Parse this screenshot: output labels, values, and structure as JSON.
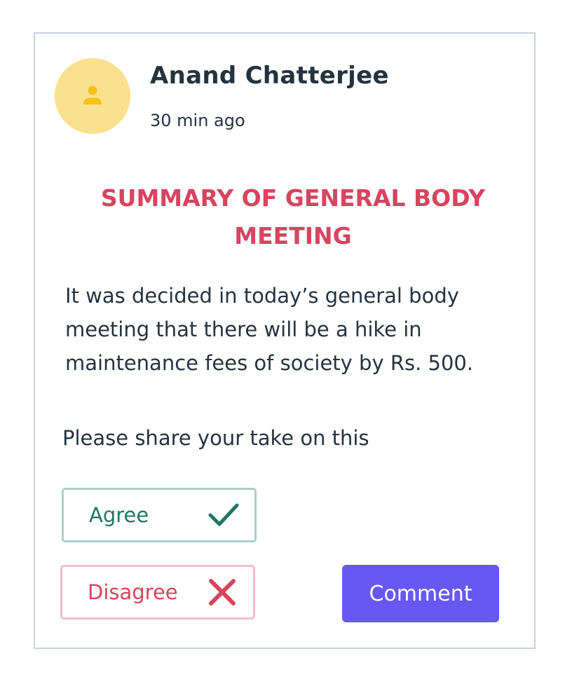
{
  "post": {
    "author": "Anand Chatterjee",
    "time": "30 min ago",
    "avatar_icon": "user-icon",
    "title": "SUMMARY OF GENERAL BODY MEETING",
    "body": "It was decided in today’s general body meeting that there will be a hike in maintenance fees of society by Rs. 500.",
    "prompt": "Please share your take on this"
  },
  "actions": {
    "agree_label": "Agree",
    "agree_icon": "check-icon",
    "disagree_label": "Disagree",
    "disagree_icon": "close-icon",
    "comment_label": "Comment"
  },
  "colors": {
    "accent": "#6758f6",
    "title": "#d6455e",
    "agree": "#1f7766",
    "agree_border": "#a9d0c8",
    "disagree": "#d6455e",
    "disagree_border": "#efbfca",
    "avatar_bg": "#fbe08e",
    "avatar_icon": "#f5c21b",
    "text": "#25333f"
  }
}
